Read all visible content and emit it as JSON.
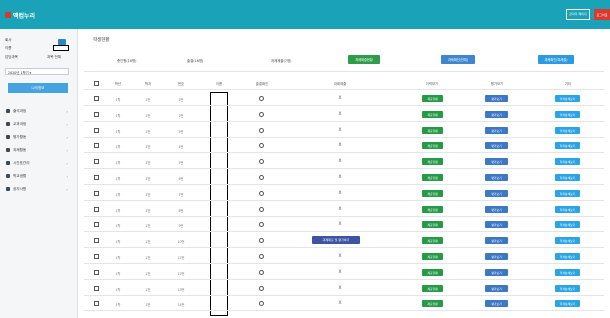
{
  "header": {
    "app_title": "맥컴누리",
    "admin_btn_label": "관리자 페이지",
    "logout_label": "로그아웃"
  },
  "sidebar": {
    "info_rows": [
      {
        "label": "회사",
        "value": ""
      },
      {
        "label": "이름",
        "value": ""
      },
      {
        "label": "담당과목",
        "value": "과목 전체"
      }
    ],
    "select_value": "2020년 1학기 ▾",
    "action_label": "나의정보",
    "menu": [
      {
        "label": "출석과정"
      },
      {
        "label": "교과과정"
      },
      {
        "label": "평가활동"
      },
      {
        "label": "과제활동"
      },
      {
        "label": "시간표관리"
      },
      {
        "label": "학교생활"
      },
      {
        "label": "공지사항"
      }
    ]
  },
  "main": {
    "title": "학생현황",
    "summary": {
      "total_label": "총인원(16명)",
      "attend_label": "출결(16명)",
      "task_label": "과제제출(7명)",
      "green_btn": "과제제출현황",
      "blue_btn": "과제확인(전체)",
      "sky_btn": "과제확인(미제출)"
    },
    "columns": [
      "학년",
      "학과",
      "번호",
      "이름",
      "출결확인",
      "과제제출",
      "이력보기",
      "평가보기",
      "기타"
    ],
    "rows": [
      {
        "grade": "1학",
        "dept": "1반",
        "num": "1번",
        "attend": "O",
        "task": "X"
      },
      {
        "grade": "1학",
        "dept": "1반",
        "num": "2번",
        "attend": "O",
        "task": "X"
      },
      {
        "grade": "1학",
        "dept": "1반",
        "num": "3번",
        "attend": "O",
        "task": "X"
      },
      {
        "grade": "1학",
        "dept": "1반",
        "num": "4번",
        "attend": "O",
        "task": "X"
      },
      {
        "grade": "1학",
        "dept": "1반",
        "num": "5번",
        "attend": "O",
        "task": "X"
      },
      {
        "grade": "1학",
        "dept": "1반",
        "num": "6번",
        "attend": "O",
        "task": "X"
      },
      {
        "grade": "1학",
        "dept": "1반",
        "num": "7번",
        "attend": "O",
        "task": "X"
      },
      {
        "grade": "1학",
        "dept": "1반",
        "num": "8번",
        "attend": "O",
        "task": "X"
      },
      {
        "grade": "1학",
        "dept": "1반",
        "num": "9번",
        "attend": "O",
        "task": "X"
      },
      {
        "grade": "1학",
        "dept": "1반",
        "num": "10번",
        "attend": "O",
        "task": "과제제출 및 평가하기"
      },
      {
        "grade": "1학",
        "dept": "1반",
        "num": "11번",
        "attend": "O",
        "task": "X"
      },
      {
        "grade": "1학",
        "dept": "1반",
        "num": "12번",
        "attend": "O",
        "task": "X"
      },
      {
        "grade": "1학",
        "dept": "1반",
        "num": "13번",
        "attend": "O",
        "task": "X"
      },
      {
        "grade": "1학",
        "dept": "1반",
        "num": "14번",
        "attend": "O",
        "task": "X"
      }
    ],
    "row_buttons": {
      "history": "제출현황",
      "view": "평가보기",
      "etc": "학적상세보기"
    }
  }
}
